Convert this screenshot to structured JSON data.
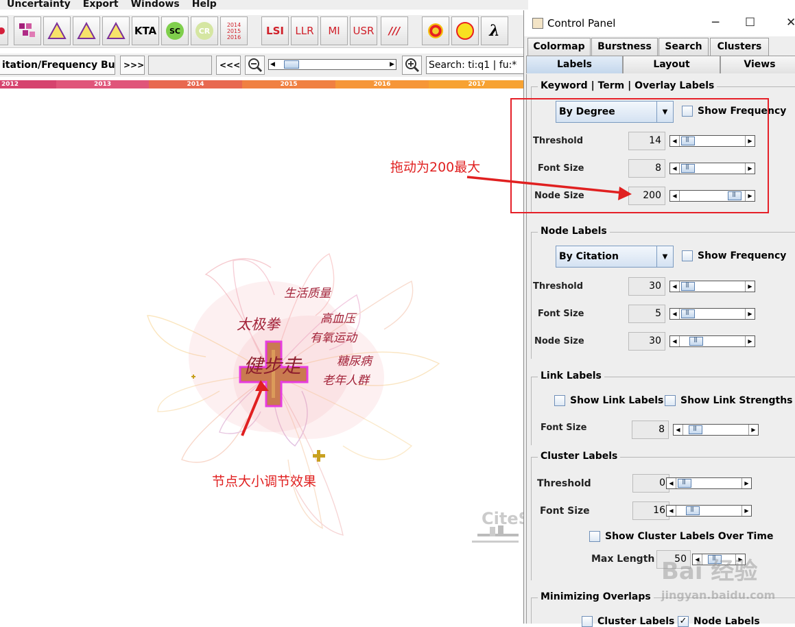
{
  "menu": [
    "Uncertainty",
    "Export",
    "Windows",
    "Help"
  ],
  "toolbar": {
    "buttons": [
      "KTA",
      "SC",
      "CR",
      "2014 2015 2016",
      "LSI",
      "LLR",
      "MI",
      "USR",
      "///",
      "λ"
    ]
  },
  "nav": {
    "mode_label": "itation/Frequency Burst",
    "next_label": ">>>",
    "prev_label": "<<<",
    "search_text": "Search: ti:q1 | fu:*"
  },
  "timeline": {
    "years": [
      "2012",
      "2013",
      "2014",
      "2015",
      "2016",
      "2017"
    ],
    "colors": [
      "#d6436e",
      "#e0557a",
      "#e86850",
      "#f08042",
      "#f69638",
      "#f7a232"
    ]
  },
  "network": {
    "keywords": [
      "健步走",
      "太极拳",
      "生活质量",
      "高血压",
      "有氧运动",
      "糖尿病",
      "老年人群"
    ],
    "annotation_node": "节点大小调节效果",
    "watermark": "CiteS"
  },
  "panel": {
    "title": "Control Panel",
    "tabs_row1": [
      "Colormap",
      "Burstness",
      "Search",
      "Clusters"
    ],
    "tabs_row2": [
      "Labels",
      "Layout",
      "Views"
    ],
    "keyword_group": {
      "title": "Keyword | Term | Overlay Labels",
      "combo": "By Degree",
      "show_frequency": "Show Frequency",
      "threshold_label": "Threshold",
      "threshold": "14",
      "font_size_label": "Font Size",
      "font_size": "8",
      "node_size_label": "Node Size",
      "node_size": "200",
      "annotation": "拖动为200最大"
    },
    "node_group": {
      "title": "Node Labels",
      "combo": "By Citation",
      "show_frequency": "Show Frequency",
      "threshold_label": "Threshold",
      "threshold": "30",
      "font_size_label": "Font Size",
      "font_size": "5",
      "node_size_label": "Node Size",
      "node_size": "30"
    },
    "link_group": {
      "title": "Link Labels",
      "show_link_labels": "Show Link Labels",
      "show_link_strengths": "Show Link Strengths",
      "font_size_label": "Font Size",
      "font_size": "8"
    },
    "cluster_group": {
      "title": "Cluster Labels",
      "threshold_label": "Threshold",
      "threshold": "0",
      "font_size_label": "Font Size",
      "font_size": "16",
      "show_over_time": "Show Cluster Labels Over Time",
      "max_length_label": "Max Length",
      "max_length": "50"
    },
    "overlap_group": {
      "title": "Minimizing Overlaps",
      "cluster_labels": "Cluster Labels",
      "node_labels": "Node Labels"
    },
    "watermark": "Bai 经验",
    "watermark_url": "jingyan.baidu.com"
  }
}
